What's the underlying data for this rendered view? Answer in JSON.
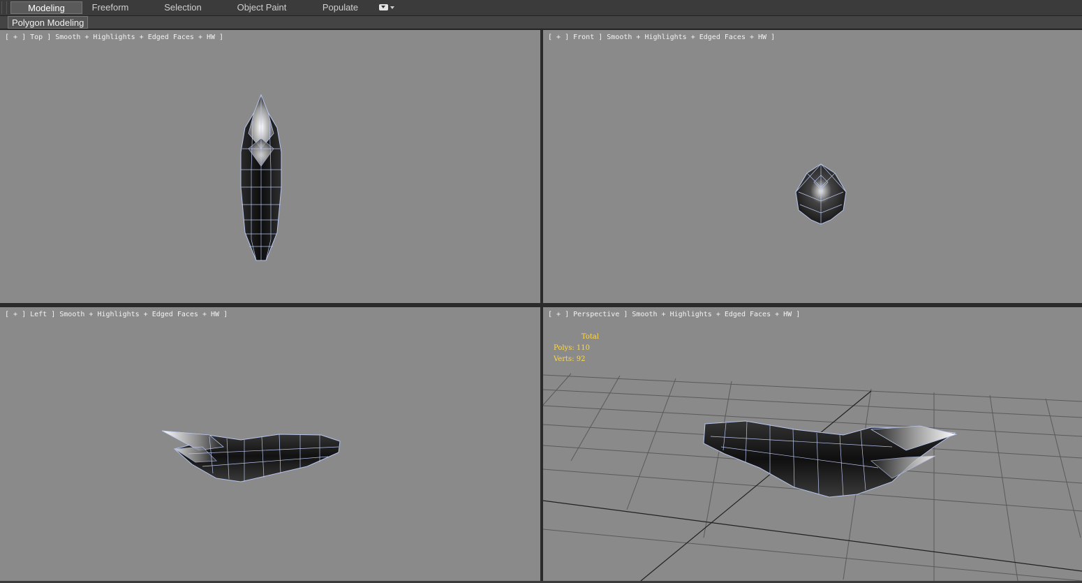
{
  "ribbon": {
    "tabs": [
      {
        "label": "Modeling",
        "active": true
      },
      {
        "label": "Freeform"
      },
      {
        "label": "Selection"
      },
      {
        "label": "Object Paint"
      },
      {
        "label": "Populate"
      }
    ]
  },
  "subbar": {
    "active_panel": "Polygon Modeling"
  },
  "viewports": {
    "top": {
      "label": "[ + ] Top ] Smooth + Highlights + Edged Faces + HW ]"
    },
    "front": {
      "label": "[ + ] Front ] Smooth + Highlights + Edged Faces + HW ]"
    },
    "left": {
      "label": "[ + ] Left ] Smooth + Highlights + Edged Faces + HW ]"
    },
    "perspective": {
      "label": "[ + ] Perspective ] Smooth + Highlights + Edged Faces + HW ]",
      "stats": {
        "title": "Total",
        "polys": "Polys: 110",
        "verts": "Verts: 92"
      }
    }
  },
  "colors": {
    "viewport_bg": "#8a8a8a",
    "mesh_dark": "#141414",
    "wire": "#aab8e6",
    "stats_text": "#ffd84a",
    "grid": "#4a4a4a"
  }
}
